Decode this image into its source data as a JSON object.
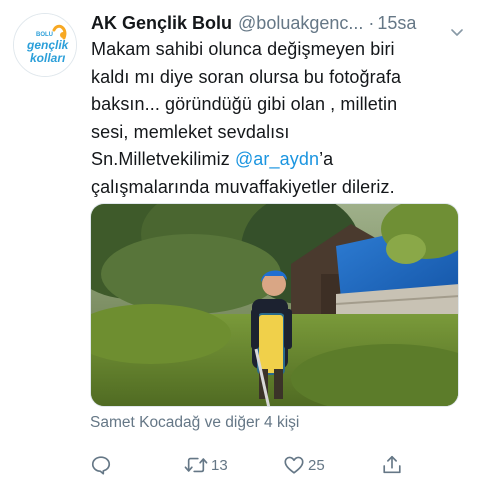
{
  "tweet": {
    "author": {
      "display_name": "AK Gençlik Bolu",
      "handle": "@boluakgenc...",
      "avatar_logo": {
        "top_text": "BOLU",
        "line1": "gençlik",
        "line2": "kolları"
      }
    },
    "separator": "·",
    "time": "15sa",
    "text_lines": [
      "Makam sahibi olunca değişmeyen biri",
      "kaldı mı diye soran olursa bu fotoğrafa",
      "baksın... göründüğü gibi olan , milletin",
      "sesi, memleket sevdalısı"
    ],
    "text_line5_before": "Sn.Milletvekilimiz ",
    "mention": "@ar_aydn",
    "text_line5_after": "’a",
    "text_line6": "çalışmalarında muvaffakiyetler dileriz.",
    "tagged": "Samet Kocadağ ve diğer 4 kişi",
    "actions": {
      "reply_count": "",
      "retweet_count": "13",
      "like_count": "25"
    },
    "icons": {
      "more": "chevron-down-icon",
      "reply": "reply-icon",
      "retweet": "retweet-icon",
      "like": "heart-icon",
      "share": "share-icon"
    },
    "colors": {
      "text": "#14171a",
      "secondary": "#657786",
      "link": "#1b95e0"
    }
  }
}
